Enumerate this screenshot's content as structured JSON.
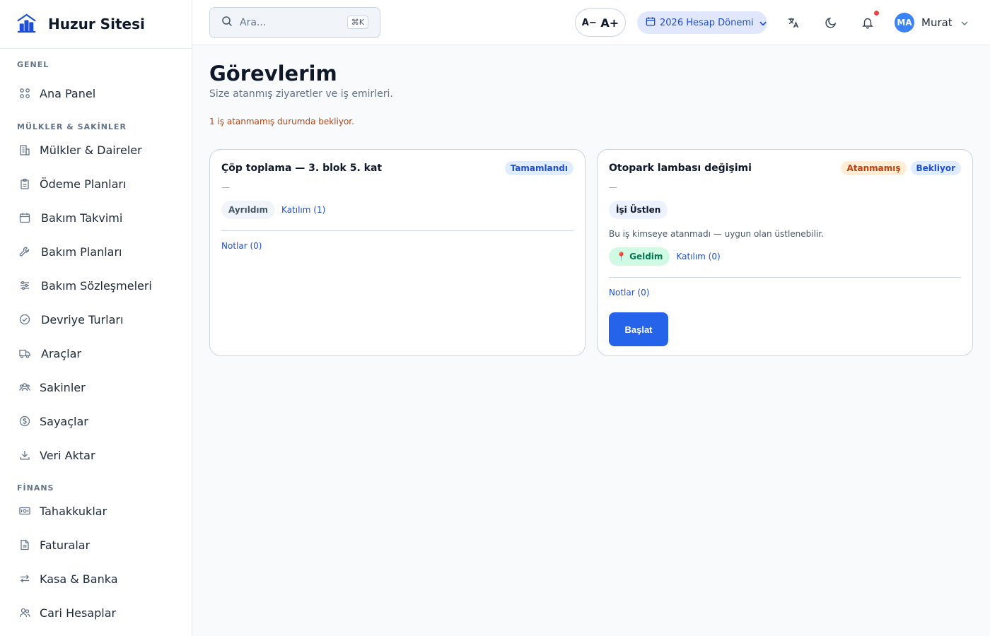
{
  "brand": {
    "name": "Huzur Sitesi",
    "icon": "building-chart-icon"
  },
  "sidebar": {
    "sections": [
      {
        "title": "GENEL",
        "items": [
          {
            "label": "Ana Panel",
            "icon": "grid-icon"
          }
        ]
      },
      {
        "title": "MÜLKLER & SAKİNLER",
        "items": [
          {
            "label": "Mülkler & Daireler",
            "icon": "building-icon"
          },
          {
            "label": "Ödeme Planları",
            "icon": "clipboard-icon"
          },
          {
            "label": "Bakım Takvimi",
            "icon": "calendar-icon"
          },
          {
            "label": "Bakım Planları",
            "icon": "wrench-icon"
          },
          {
            "label": "Bakım Sözleşmeleri",
            "icon": "sliders-icon"
          },
          {
            "label": "Devriye Turları",
            "icon": "check-circle-icon"
          },
          {
            "label": "Araçlar",
            "icon": "truck-icon"
          },
          {
            "label": "Sakinler",
            "icon": "users-icon"
          },
          {
            "label": "Sayaçlar",
            "icon": "dollar-circle-icon"
          },
          {
            "label": "Veri Aktar",
            "icon": "download-icon"
          }
        ]
      },
      {
        "title": "FİNANS",
        "items": [
          {
            "label": "Tahakkuklar",
            "icon": "banknote-icon"
          },
          {
            "label": "Faturalar",
            "icon": "file-icon"
          },
          {
            "label": "Kasa & Banka",
            "icon": "swap-icon"
          },
          {
            "label": "Cari Hesaplar",
            "icon": "people-icon"
          }
        ]
      }
    ]
  },
  "header": {
    "search_placeholder": "Ara...",
    "search_shortcut": "⌘K",
    "font_decrease": "A−",
    "font_increase": "A+",
    "period_label": "2026 Hesap Dönemi",
    "user": {
      "initials": "MA",
      "name": "Murat"
    }
  },
  "page": {
    "title": "Görevlerim",
    "subtitle": "Size atanmış ziyaretler ve iş emirleri.",
    "warning": "1 iş atanmamış durumda bekliyor."
  },
  "tasks": [
    {
      "title": "Çöp toplama — 3. blok 5. kat",
      "badges": [
        "Tamamlandı"
      ],
      "description": "—",
      "status_pill": "Ayrıldım",
      "attendance_link": "Katılım (1)",
      "notes_link": "Notlar (0)"
    },
    {
      "title": "Otopark lambası değişimi",
      "badges": [
        "Atanmamış",
        "Bekliyor"
      ],
      "description": "—",
      "claim_label": "İşi Üstlen",
      "help_text": "Bu iş kimseye atanmadı — uygun olan üstlenebilir.",
      "status_pill": "📍 Geldim",
      "attendance_link": "Katılım (0)",
      "notes_link": "Notlar (0)",
      "primary_action": "Başlat"
    }
  ]
}
